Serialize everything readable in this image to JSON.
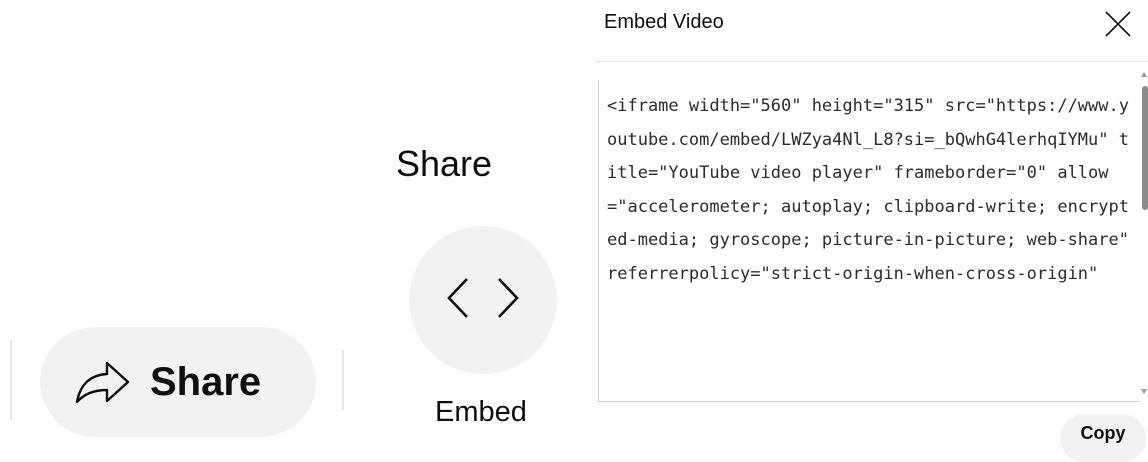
{
  "share_pill": {
    "label": "Share",
    "icon": "share-arrow-icon"
  },
  "share_panel": {
    "heading": "Share",
    "embed_label": "Embed",
    "embed_icon": "code-brackets-icon"
  },
  "embed_dialog": {
    "title": "Embed Video",
    "close_icon": "close-icon",
    "code": "<iframe width=\"560\" height=\"315\" src=\"https://www.youtube.com/embed/LWZya4Nl_L8?si=_bQwhG4lerhqIYMu\" title=\"YouTube video player\" frameborder=\"0\" allow=\"accelerometer; autoplay; clipboard-write; encrypted-media; gyroscope; picture-in-picture; web-share\" referrerpolicy=\"strict-origin-when-cross-origin\"",
    "copy_label": "Copy"
  },
  "colors": {
    "pill_bg": "#f2f2f2",
    "text": "#0f0f0f",
    "scroll_thumb": "#8a8a8a"
  }
}
